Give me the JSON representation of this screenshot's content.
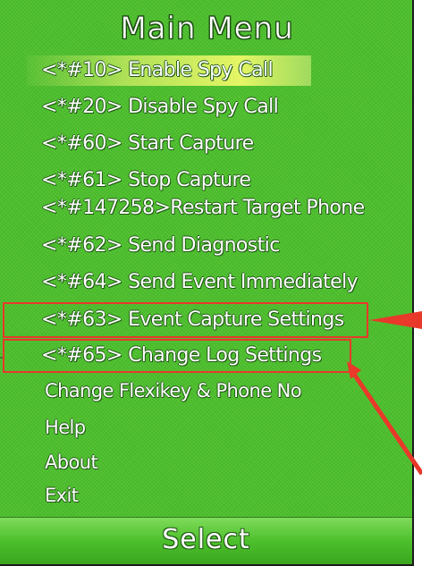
{
  "screen": {
    "title": "Main Menu",
    "softkey_label": "Select"
  },
  "menu": {
    "items": [
      {
        "label": "<*#10> Enable Spy Call",
        "selected": true
      },
      {
        "label": "<*#20> Disable Spy Call"
      },
      {
        "label": "<*#60> Start Capture"
      },
      {
        "label": "<*#61> Stop Capture"
      },
      {
        "label": "<*#147258>Restart Target Phone"
      },
      {
        "label": "<*#62> Send Diagnostic"
      },
      {
        "label": "<*#64> Send Event Immediately"
      },
      {
        "label": "<*#63> Event Capture Settings"
      },
      {
        "label": "<*#65> Change Log Settings"
      },
      {
        "label": "Change Flexikey & Phone No"
      },
      {
        "label": "Help"
      },
      {
        "label": "About"
      },
      {
        "label": "Exit"
      }
    ]
  },
  "colors": {
    "background": "#4cbf2c",
    "highlight": "#ffff70",
    "text": "#ffffff",
    "callout": "#e8392a"
  }
}
